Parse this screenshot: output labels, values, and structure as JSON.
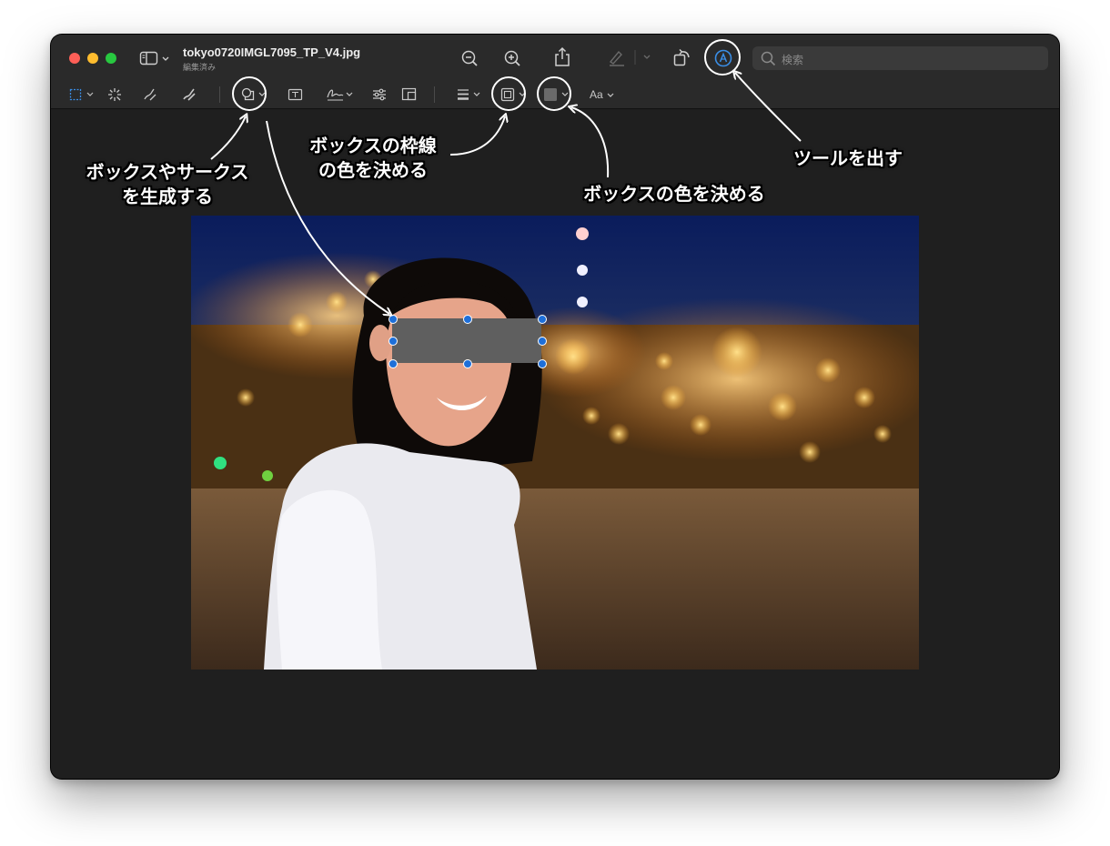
{
  "window": {
    "title": "tokyo0720IMGL7095_TP_V4.jpg",
    "subtitle": "編集済み"
  },
  "search": {
    "placeholder": "検索"
  },
  "toolbar": {
    "icons": [
      "sidebar-icon",
      "zoom-out-icon",
      "zoom-in-icon",
      "share-icon",
      "highlight-icon",
      "rotate-icon",
      "markup-icon"
    ],
    "markup_tools": [
      "selection-icon",
      "instant-alpha-icon",
      "sketch-icon",
      "draw-icon",
      "shapes-icon",
      "text-icon",
      "sign-icon",
      "adjust-color-icon",
      "adjust-size-icon",
      "shape-style-icon",
      "border-color-icon",
      "fill-color-icon"
    ],
    "text_style_label": "Aa"
  },
  "annotations": {
    "shapes": [
      "ボックスやサークス",
      "を生成する"
    ],
    "border": [
      "ボックスの枠線",
      "の色を決める"
    ],
    "fill": "ボックスの色を決める",
    "tools": "ツールを出す"
  },
  "colors": {
    "window_bg": "#1f1f1f",
    "toolbar_bg": "#2a2a2a",
    "accent": "#3a8ee6",
    "box_fill": "#5f5f5f",
    "handle": "#1e6fd9"
  }
}
